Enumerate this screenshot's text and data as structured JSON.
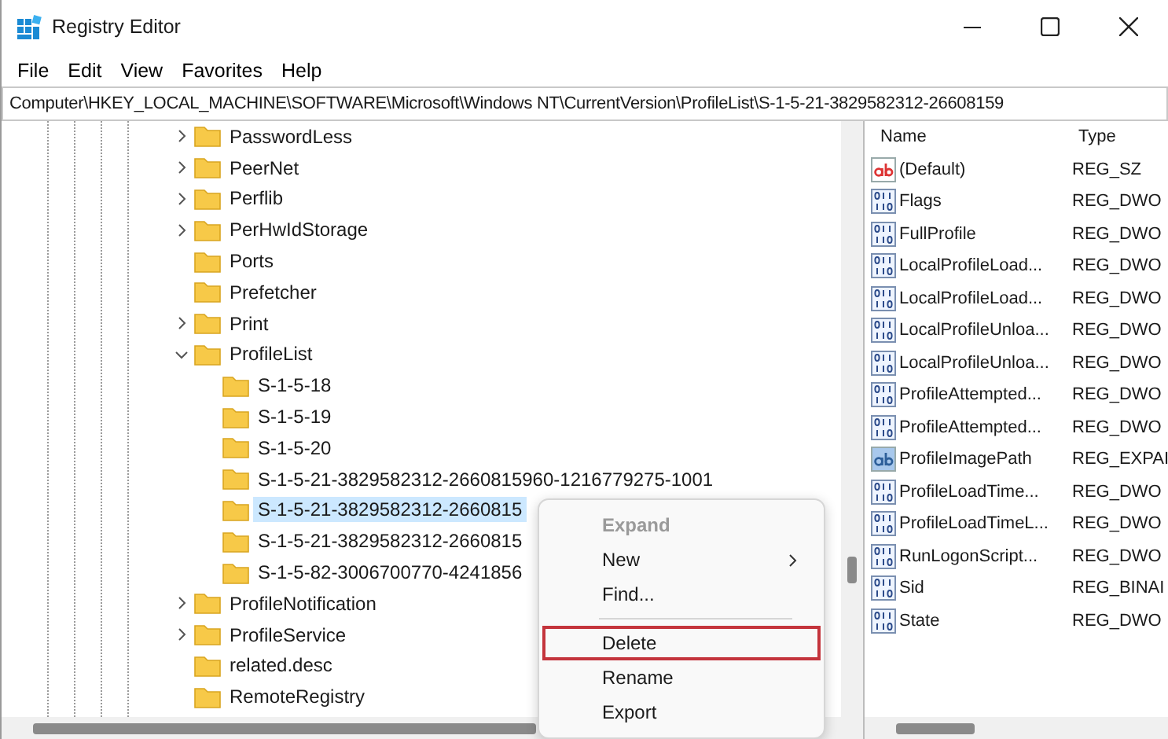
{
  "window": {
    "title": "Registry Editor"
  },
  "menu_bar": [
    "File",
    "Edit",
    "View",
    "Favorites",
    "Help"
  ],
  "address": "Computer\\HKEY_LOCAL_MACHINE\\SOFTWARE\\Microsoft\\Windows NT\\CurrentVersion\\ProfileList\\S-1-5-21-3829582312-26608159",
  "tree": [
    {
      "label": "PasswordLess",
      "expandable": true,
      "expanded": false,
      "selected": false
    },
    {
      "label": "PeerNet",
      "expandable": true,
      "expanded": false,
      "selected": false
    },
    {
      "label": "Perflib",
      "expandable": true,
      "expanded": false,
      "selected": false
    },
    {
      "label": "PerHwIdStorage",
      "expandable": true,
      "expanded": false,
      "selected": false
    },
    {
      "label": "Ports",
      "expandable": false,
      "selected": false
    },
    {
      "label": "Prefetcher",
      "expandable": false,
      "selected": false
    },
    {
      "label": "Print",
      "expandable": true,
      "expanded": false,
      "selected": false
    },
    {
      "label": "ProfileList",
      "expandable": true,
      "expanded": true,
      "selected": false,
      "children": [
        {
          "label": "S-1-5-18",
          "expandable": false,
          "selected": false
        },
        {
          "label": "S-1-5-19",
          "expandable": false,
          "selected": false
        },
        {
          "label": "S-1-5-20",
          "expandable": false,
          "selected": false
        },
        {
          "label": "S-1-5-21-3829582312-2660815960-1216779275-1001",
          "expandable": false,
          "selected": false
        },
        {
          "label": "S-1-5-21-3829582312-2660815",
          "expandable": false,
          "selected": true
        },
        {
          "label": "S-1-5-21-3829582312-2660815",
          "expandable": false,
          "selected": false
        },
        {
          "label": "S-1-5-82-3006700770-4241856",
          "expandable": false,
          "selected": false
        }
      ]
    },
    {
      "label": "ProfileNotification",
      "expandable": true,
      "expanded": false,
      "selected": false
    },
    {
      "label": "ProfileService",
      "expandable": true,
      "expanded": false,
      "selected": false
    },
    {
      "label": "related.desc",
      "expandable": false,
      "selected": false
    },
    {
      "label": "RemoteRegistry",
      "expandable": false,
      "selected": false
    }
  ],
  "values": {
    "columns": [
      "Name",
      "Type"
    ],
    "rows": [
      {
        "kind": "string",
        "name": "(Default)",
        "type": "REG_SZ"
      },
      {
        "kind": "binary",
        "name": "Flags",
        "type": "REG_DWO"
      },
      {
        "kind": "binary",
        "name": "FullProfile",
        "type": "REG_DWO"
      },
      {
        "kind": "binary",
        "name": "LocalProfileLoad...",
        "type": "REG_DWO"
      },
      {
        "kind": "binary",
        "name": "LocalProfileLoad...",
        "type": "REG_DWO"
      },
      {
        "kind": "binary",
        "name": "LocalProfileUnloa...",
        "type": "REG_DWO"
      },
      {
        "kind": "binary",
        "name": "LocalProfileUnloa...",
        "type": "REG_DWO"
      },
      {
        "kind": "binary",
        "name": "ProfileAttempted...",
        "type": "REG_DWO"
      },
      {
        "kind": "binary",
        "name": "ProfileAttempted...",
        "type": "REG_DWO"
      },
      {
        "kind": "expand_string",
        "name": "ProfileImagePath",
        "type": "REG_EXPAI"
      },
      {
        "kind": "binary",
        "name": "ProfileLoadTime...",
        "type": "REG_DWO"
      },
      {
        "kind": "binary",
        "name": "ProfileLoadTimeL...",
        "type": "REG_DWO"
      },
      {
        "kind": "binary",
        "name": "RunLogonScript...",
        "type": "REG_DWO"
      },
      {
        "kind": "binary",
        "name": "Sid",
        "type": "REG_BINAI"
      },
      {
        "kind": "binary",
        "name": "State",
        "type": "REG_DWO"
      }
    ]
  },
  "context_menu": [
    {
      "kind": "item",
      "label": "Expand",
      "disabled": true,
      "focused": false
    },
    {
      "kind": "item",
      "label": "New",
      "disabled": false,
      "submenu": true,
      "focused": false
    },
    {
      "kind": "item",
      "label": "Find...",
      "disabled": false,
      "focused": false
    },
    {
      "kind": "separator"
    },
    {
      "kind": "item",
      "label": "Delete",
      "disabled": false,
      "focused": true
    },
    {
      "kind": "item",
      "label": "Rename",
      "disabled": false,
      "focused": false
    },
    {
      "kind": "item",
      "label": "Export",
      "disabled": false,
      "focused": false
    }
  ]
}
